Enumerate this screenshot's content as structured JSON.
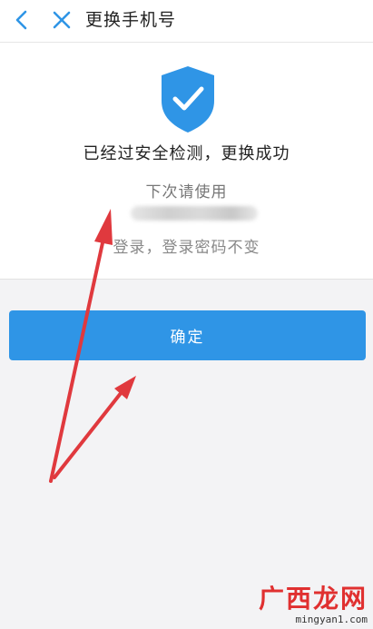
{
  "header": {
    "title": "更换手机号",
    "back_icon": "chevron-left-icon",
    "close_icon": "close-icon"
  },
  "result": {
    "icon": "shield-check-icon",
    "main_message": "已经过安全检测，更换成功",
    "next_use_text": "下次请使用",
    "login_text": "登录，登录密码不变"
  },
  "actions": {
    "confirm_label": "确定"
  },
  "watermark": {
    "site_name": "广西龙网",
    "site_url": "mingyan1.com"
  },
  "colors": {
    "accent": "#2f95e6",
    "annotation_arrow": "#e0393e",
    "watermark_red": "#e03030"
  }
}
